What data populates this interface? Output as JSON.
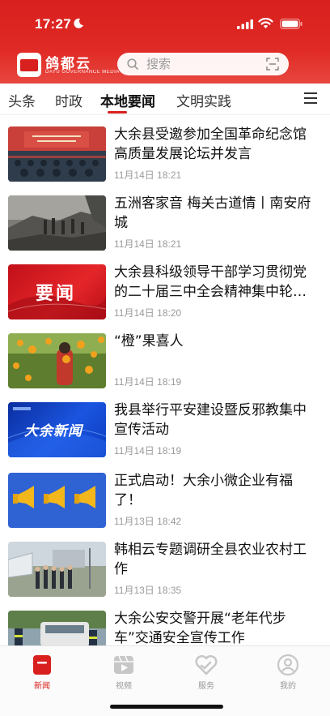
{
  "status_bar": {
    "time": "17:27"
  },
  "header": {
    "logo_text": "鸽都云",
    "logo_sub": "DAYU GOVERNANCE MEDIA",
    "search_placeholder": "搜索"
  },
  "tabs": [
    {
      "label": "头条",
      "active": false
    },
    {
      "label": "时政",
      "active": false
    },
    {
      "label": "本地要闻",
      "active": true
    },
    {
      "label": "文明实践",
      "active": false
    }
  ],
  "news": [
    {
      "title": "大余县受邀参加全国革命纪念馆高质量发展论坛并发言",
      "time": "11月14日 18:21",
      "thumb": "conference-photo"
    },
    {
      "title": "五洲客家音  梅关古道情丨南安府城",
      "time": "11月14日 18:21",
      "thumb": "ancient-road-photo"
    },
    {
      "title": "大余县科级领导干部学习贯彻党的二十届三中全会精神集中轮…",
      "time": "11月14日 18:20",
      "thumb": "yaowen-banner",
      "thumb_text": "要闻"
    },
    {
      "title": "“橙”果喜人",
      "time": "11月14日 18:19",
      "thumb": "orange-orchard-photo"
    },
    {
      "title": "我县举行平安建设暨反邪教集中宣传活动",
      "time": "11月14日 18:19",
      "thumb": "dayu-news-banner",
      "thumb_text": "大余新闻"
    },
    {
      "title": "正式启动！大余小微企业有福了！",
      "time": "11月13日 18:42",
      "thumb": "megaphone-banner"
    },
    {
      "title": "韩相云专题调研全县农业农村工作",
      "time": "11月13日 18:35",
      "thumb": "greenhouse-photo"
    },
    {
      "title": "大余公安交警开展“老年代步车”交通安全宣传工作",
      "time": "",
      "thumb": "traffic-police-photo"
    }
  ],
  "bottom_tabs": [
    {
      "label": "新闻",
      "icon": "news-icon",
      "active": true
    },
    {
      "label": "视频",
      "icon": "video-icon",
      "active": false
    },
    {
      "label": "服务",
      "icon": "service-icon",
      "active": false
    },
    {
      "label": "我的",
      "icon": "profile-icon",
      "active": false
    }
  ],
  "colors": {
    "brand_red": "#d8201e",
    "text": "#111111",
    "meta": "#9a9a9a"
  }
}
